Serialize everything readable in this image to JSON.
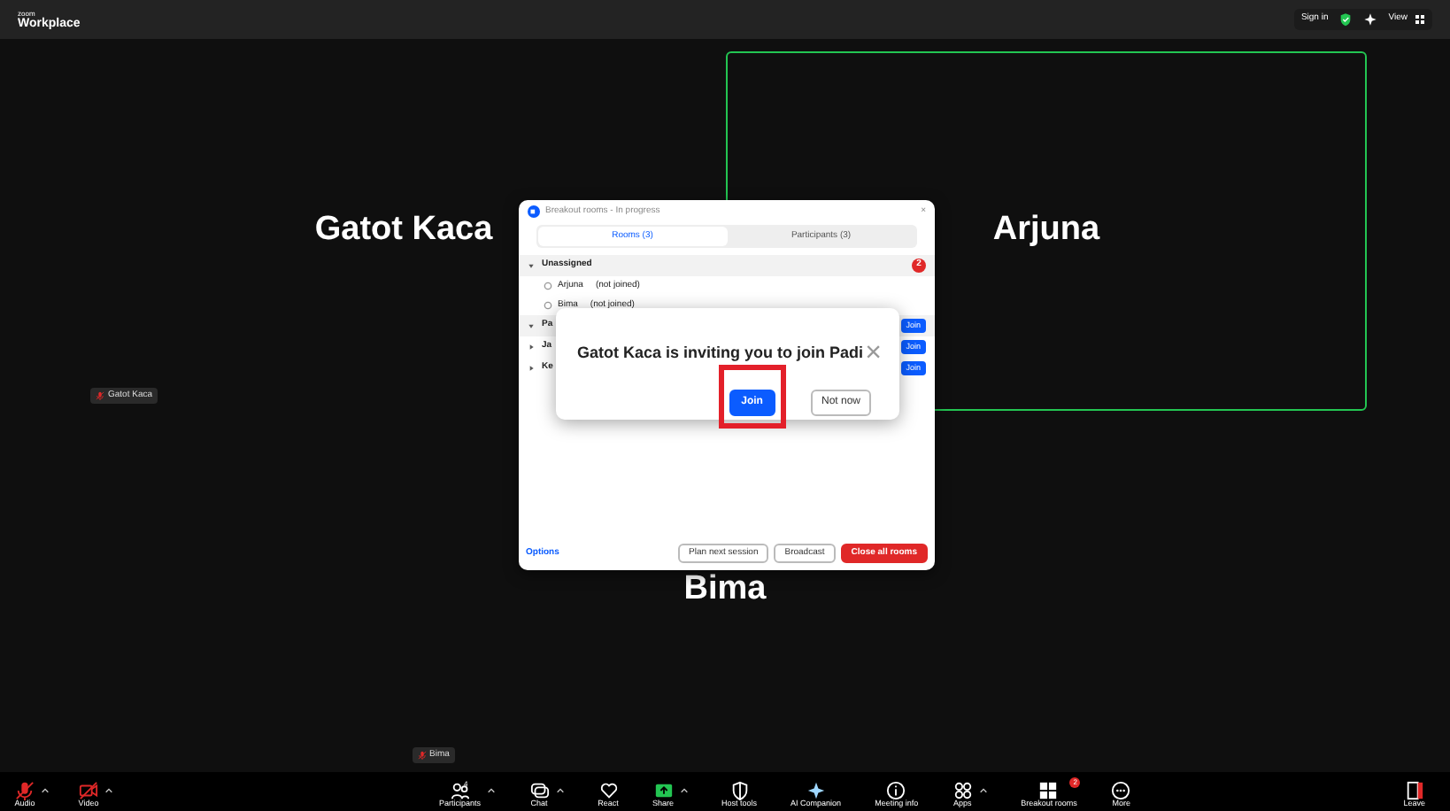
{
  "top_bar": {
    "logo_small": "zoom",
    "logo": "Workplace",
    "sign_in": "Sign in",
    "view": "View"
  },
  "tiles": [
    {
      "name": "Gatot Kaca",
      "name_tag": "Gatot Kaca",
      "active_speaker": false
    },
    {
      "name": "Arjuna",
      "active_speaker": true
    },
    {
      "name": "Bima",
      "name_tag": "Bima",
      "active_speaker": false
    }
  ],
  "breakout_dialog": {
    "title": "Breakout rooms - In progress",
    "close": "×",
    "tabs": [
      {
        "label": "Rooms (3)",
        "selected": true
      },
      {
        "label": "Participants (3)",
        "selected": false
      }
    ],
    "rooms": [
      {
        "name": "Unassigned",
        "badge": "2",
        "expanded": true,
        "members": [
          {
            "name": "Arjuna",
            "status": "(not joined)"
          },
          {
            "name": "Bima",
            "status": "(not joined)"
          }
        ]
      },
      {
        "name": "Pa",
        "join": "Join",
        "expanded": true
      },
      {
        "name": "Ja",
        "join": "Join",
        "expanded": false
      },
      {
        "name": "Ke",
        "join": "Join",
        "expanded": false
      }
    ],
    "options": "Options",
    "buttons": [
      {
        "label": "Plan next session",
        "kind": "outline"
      },
      {
        "label": "Broadcast",
        "kind": "outline"
      },
      {
        "label": "Close all rooms",
        "kind": "danger"
      }
    ]
  },
  "invite_popup": {
    "message": "Gatot Kaca is inviting you to join Padi",
    "close": "×",
    "buttons": [
      {
        "label": "Join",
        "kind": "primary",
        "highlighted": true
      },
      {
        "label": "Not now",
        "kind": "outline",
        "highlighted": false
      }
    ]
  },
  "toolbar": {
    "left": [
      {
        "label": "Audio",
        "kind": "audio",
        "caret": true
      },
      {
        "label": "Video",
        "kind": "video",
        "caret": true
      }
    ],
    "center": [
      {
        "label": "Participants",
        "kind": "participants",
        "count": "4",
        "caret": true
      },
      {
        "label": "Chat",
        "kind": "chat",
        "caret": true
      },
      {
        "label": "React",
        "kind": "react",
        "caret": false
      },
      {
        "label": "Share",
        "kind": "share",
        "caret": true
      },
      {
        "label": "Host tools",
        "kind": "host",
        "caret": false
      },
      {
        "label": "AI Companion",
        "kind": "ai",
        "caret": false
      },
      {
        "label": "Meeting info",
        "kind": "info",
        "caret": false
      },
      {
        "label": "Apps",
        "kind": "apps",
        "caret": true
      },
      {
        "label": "Breakout rooms",
        "kind": "breakout",
        "badge": "2",
        "caret": false
      },
      {
        "label": "More",
        "kind": "more",
        "caret": false
      }
    ],
    "right": [
      {
        "label": "Leave",
        "kind": "leave",
        "caret": false
      }
    ]
  }
}
